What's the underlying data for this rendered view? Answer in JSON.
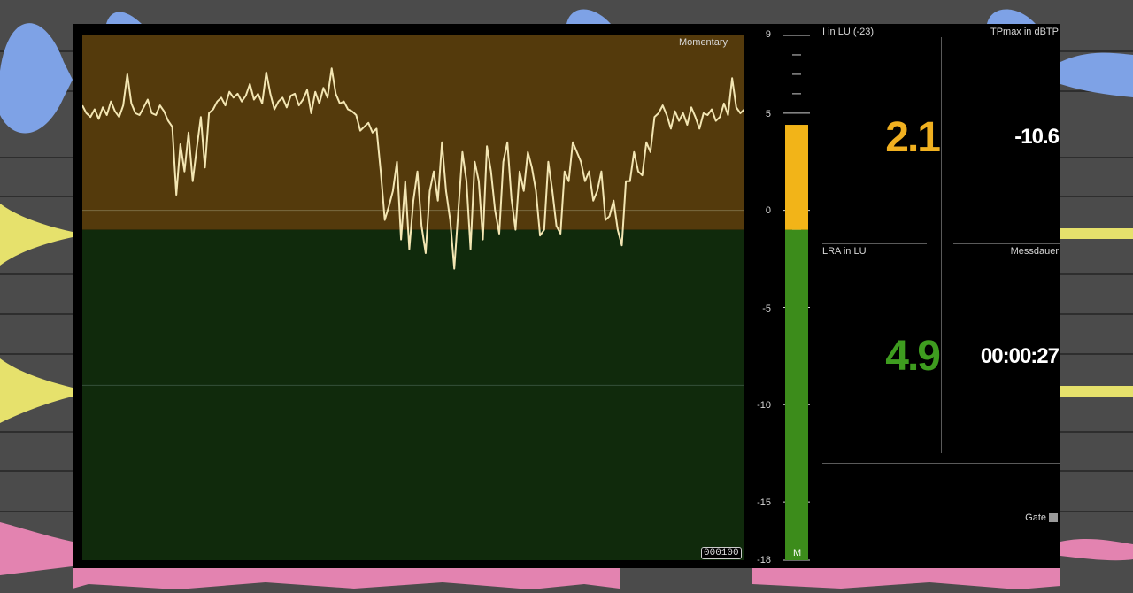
{
  "graph": {
    "label": "Momentary",
    "counter": "000100",
    "trace": [
      5.4,
      5.0,
      4.8,
      5.2,
      4.7,
      5.3,
      4.9,
      5.6,
      5.1,
      4.8,
      5.4,
      7.0,
      5.5,
      5.0,
      4.9,
      5.3,
      5.7,
      5.0,
      4.9,
      5.4,
      5.1,
      4.6,
      4.3,
      0.8,
      3.4,
      2.0,
      4.0,
      1.5,
      3.2,
      4.8,
      2.2,
      5.0,
      5.2,
      5.6,
      5.8,
      5.4,
      6.1,
      5.8,
      6.0,
      5.6,
      5.9,
      6.5,
      5.7,
      6.0,
      5.5,
      7.1,
      6.0,
      5.2,
      5.6,
      5.8,
      5.3,
      5.9,
      6.0,
      5.4,
      5.7,
      6.2,
      5.0,
      6.1,
      5.5,
      6.3,
      5.8,
      7.3,
      6.0,
      5.5,
      5.6,
      5.2,
      5.1,
      4.9,
      4.1,
      4.3,
      4.5,
      4.0,
      4.2,
      2.0,
      -0.5,
      0.2,
      1.0,
      2.5,
      -1.5,
      1.5,
      -2.0,
      0.5,
      2.0,
      -0.8,
      -2.2,
      1.0,
      2.0,
      0.5,
      3.5,
      1.0,
      -0.5,
      -3.0,
      0.0,
      3.0,
      1.5,
      -2.0,
      2.5,
      1.5,
      -1.5,
      3.3,
      2.0,
      0.0,
      -1.2,
      2.5,
      3.5,
      0.6,
      -1.0,
      2.0,
      1.0,
      3.0,
      2.2,
      1.0,
      -1.3,
      -1.0,
      2.5,
      1.0,
      -0.8,
      -1.2,
      2.0,
      1.5,
      3.5,
      3.0,
      2.5,
      1.5,
      2.0,
      0.5,
      1.0,
      2.0,
      -0.5,
      -0.3,
      0.5,
      -1.0,
      -1.8,
      1.5,
      1.5,
      3.0,
      2.0,
      1.8,
      3.5,
      3.0,
      4.8,
      5.0,
      5.4,
      4.9,
      4.2,
      5.1,
      4.6,
      5.0,
      4.4,
      5.3,
      4.8,
      4.2,
      5.0,
      4.9,
      5.2,
      4.6,
      4.8,
      5.5,
      4.9,
      6.8,
      5.3,
      5.0,
      5.2
    ],
    "ylim": [
      -18,
      9
    ]
  },
  "scale": {
    "ticks": [
      "9",
      "5",
      "0",
      "-5",
      "-10",
      "-15",
      "-18"
    ],
    "bar_value": 4.4,
    "target": -1,
    "meter_label": "M"
  },
  "readouts": {
    "integrated_label": "I in LU (-23)",
    "integrated_value": "2.1",
    "tpmax_label": "TPmax in dBTP",
    "tpmax_value": "-10.6",
    "lra_label": "LRA in LU",
    "lra_value": "4.9",
    "duration_label": "Messdauer",
    "duration_value": "00:00:27",
    "gate_label": "Gate"
  },
  "colors": {
    "over": "#543a0c",
    "under": "#102a0c",
    "trace": "#f3e6b3",
    "bar_over": "#f2b418",
    "bar_under": "#3c8c1b",
    "integrated": "#f0b020",
    "lra": "#3e9c1f",
    "background_track_blue": "#7ea2e6",
    "background_track_yellow": "#e6e16c",
    "background_track_pink": "#e383b0"
  }
}
